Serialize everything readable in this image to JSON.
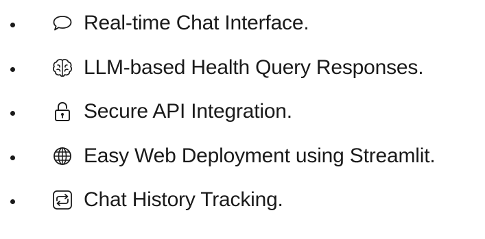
{
  "features": [
    {
      "icon": "chat-bubble-icon",
      "label": "Real-time Chat Interface."
    },
    {
      "icon": "brain-icon",
      "label": "LLM-based Health Query Responses."
    },
    {
      "icon": "lock-icon",
      "label": "Secure API Integration."
    },
    {
      "icon": "globe-icon",
      "label": "Easy Web Deployment using Streamlit."
    },
    {
      "icon": "repeat-icon",
      "label": "Chat History Tracking."
    }
  ]
}
